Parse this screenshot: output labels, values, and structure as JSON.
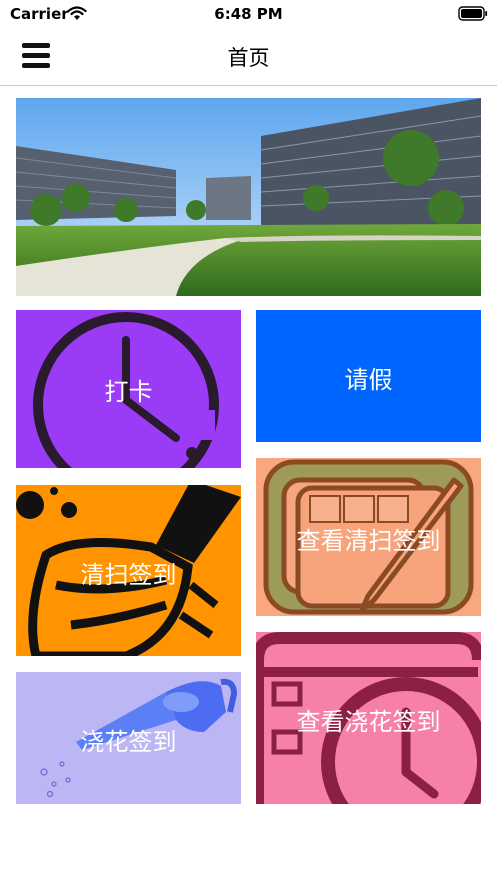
{
  "status_bar": {
    "carrier": "Carrier",
    "time": "6:48 PM"
  },
  "nav": {
    "title": "首页",
    "menu_icon": "hamburger-menu-icon"
  },
  "banner": {
    "image": "campus-building-photo"
  },
  "tiles": [
    {
      "label": "打卡",
      "color": "#9a3cf5",
      "icon": "clock-icon"
    },
    {
      "label": "请假",
      "color": "#0066ff",
      "icon": ""
    },
    {
      "label": "清扫签到",
      "color": "#ff9400",
      "icon": "broom-icon"
    },
    {
      "label": "查看清扫签到",
      "color": "#f9a77f",
      "icon": "calendar-pen-icon"
    },
    {
      "label": "浇花签到",
      "color": "#bdb6f5",
      "icon": "watering-can-icon"
    },
    {
      "label": "查看浇花签到",
      "color": "#f680a8",
      "icon": "calendar-clock-icon"
    }
  ]
}
